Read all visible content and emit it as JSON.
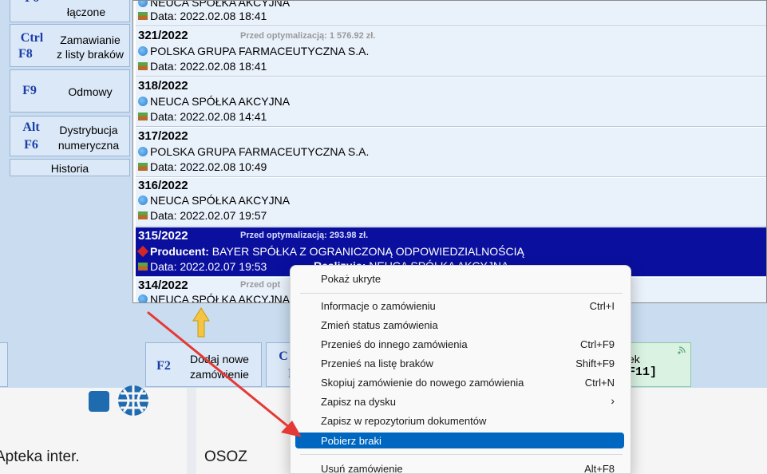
{
  "left_buttons": [
    {
      "key": "F6",
      "label": "łączone"
    },
    {
      "key_line1": "Ctrl",
      "key_line2": "F8",
      "label_line1": "Zamawianie",
      "label_line2": "z listy braków"
    },
    {
      "key": "F9",
      "label": "Odmowy"
    },
    {
      "key_line1": "Alt",
      "key_line2": "F6",
      "label_line1": "Dystrybucja",
      "label_line2": "numeryczna"
    },
    {
      "label": "Historia"
    }
  ],
  "orders": [
    {
      "number": "",
      "optimization": "",
      "supplier": "NEUCA SPÓŁKA AKCYJNA",
      "date": "Data:  2022.02.08 18:41"
    },
    {
      "number": "321/2022",
      "optimization": "Przed optymalizacją: 1 576.92 zł.",
      "supplier": "POLSKA GRUPA FARMACEUTYCZNA S.A.",
      "date": "Data:  2022.02.08 18:41"
    },
    {
      "number": "318/2022",
      "optimization": "",
      "supplier": "NEUCA SPÓŁKA AKCYJNA",
      "date": "Data:  2022.02.08 14:41"
    },
    {
      "number": "317/2022",
      "optimization": "",
      "supplier": "POLSKA GRUPA FARMACEUTYCZNA S.A.",
      "date": "Data:  2022.02.08 10:49"
    },
    {
      "number": "316/2022",
      "optimization": "",
      "supplier": "NEUCA SPÓŁKA AKCYJNA",
      "date": "Data:  2022.02.07 19:57"
    },
    {
      "number": "315/2022",
      "optimization": "Przed optymalizacją: 293.98 zł.",
      "producer_label": "Producent:",
      "supplier": "BAYER SPÓŁKA Z OGRANICZONĄ ODPOWIEDZIALNOŚCIĄ",
      "date": "Data:  2022.02.07 19:53",
      "realization_label": "Realizuje:",
      "realization": "NEUCA SPÓŁKA AKCYJNA"
    },
    {
      "number": "314/2022",
      "optimization": "Przed opt",
      "supplier": "NEUCA SPÓŁKA AKCYJNA",
      "date": ""
    }
  ],
  "toolbar": {
    "add_key": "F2",
    "add_label_line1": "Dodaj nowe",
    "add_label_line2": "zamówienie",
    "partial_key1": "C",
    "partial_key2": "F",
    "right_partial_line1": "ek",
    "right_partial_line2": "F11]"
  },
  "bottom": {
    "left_text": "Apteka inter.",
    "osoz_text": "OSOZ"
  },
  "context_menu": {
    "items": [
      {
        "label": "Pokaż ukryte",
        "shortcut": ""
      },
      {
        "label": "Informacje o zamówieniu",
        "shortcut": "Ctrl+I"
      },
      {
        "label": "Zmień status zamówienia",
        "shortcut": ""
      },
      {
        "label": "Przenieś do innego zamówienia",
        "shortcut": "Ctrl+F9"
      },
      {
        "label": "Przenieś na listę braków",
        "shortcut": "Shift+F9"
      },
      {
        "label": "Skopiuj zamówienie do nowego zamówienia",
        "shortcut": "Ctrl+N"
      },
      {
        "label": "Zapisz na dysku",
        "shortcut": "›"
      },
      {
        "label": "Zapisz w repozytorium dokumentów",
        "shortcut": ""
      },
      {
        "label": "Pobierz braki",
        "shortcut": ""
      },
      {
        "label": "Usuń zamówienie",
        "shortcut": "Alt+F8"
      }
    ]
  },
  "colors": {
    "selected_row": "#0a0f9e",
    "menu_highlight": "#0067c0",
    "annotation_arrow": "#e53935",
    "yellow_arrow": "#f4c542"
  }
}
